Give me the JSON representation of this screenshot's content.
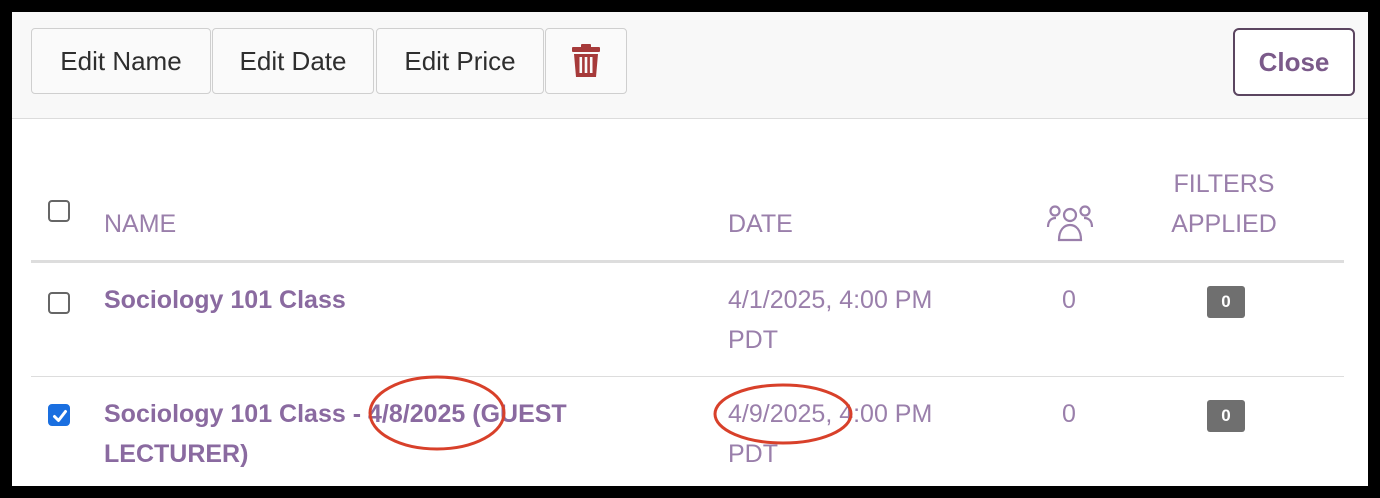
{
  "toolbar": {
    "edit_name_label": "Edit Name",
    "edit_date_label": "Edit Date",
    "edit_price_label": "Edit Price",
    "delete_icon": "trash-icon",
    "close_label": "Close"
  },
  "table": {
    "headers": {
      "name": "NAME",
      "date": "DATE",
      "attendees_icon": "people-icon",
      "filters_line1": "FILTERS",
      "filters_line2": "APPLIED"
    },
    "rows": [
      {
        "checked": false,
        "name_line1": "Sociology 101 Class",
        "name_line2": "",
        "date_line1": "4/1/2025, 4:00 PM",
        "date_line2": "PDT",
        "count": "0",
        "filters": "0"
      },
      {
        "checked": true,
        "name_line1": "Sociology 101 Class - 4/8/2025 (GUEST",
        "name_line2": "LECTURER)",
        "date_line1": "4/9/2025, 4:00 PM",
        "date_line2": "PDT",
        "count": "0",
        "filters": "0"
      }
    ]
  },
  "colors": {
    "accent": "#8a6aa0",
    "annotation": "#d8402a",
    "checkbox_checked": "#1a6fe0",
    "badge": "#6f6f6f",
    "delete": "#a63a3a"
  }
}
